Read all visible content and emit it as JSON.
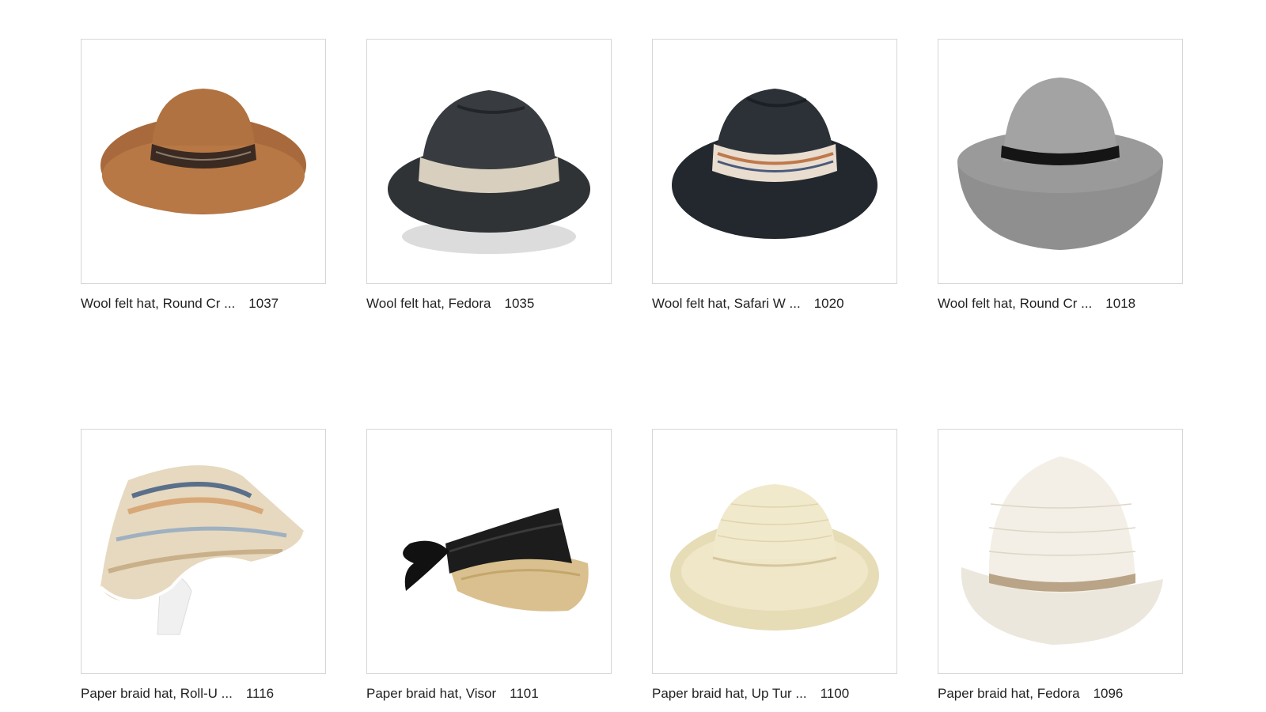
{
  "products": [
    {
      "name": "Wool felt hat, Round Cr ...",
      "code": "1037",
      "image": "brown-wide-brim-felt-hat"
    },
    {
      "name": "Wool felt hat, Fedora",
      "code": "1035",
      "image": "charcoal-fedora-beige-band"
    },
    {
      "name": "Wool felt hat, Safari W ...",
      "code": "1020",
      "image": "navy-safari-hat-patterned-band"
    },
    {
      "name": "Wool felt hat, Round Cr ...",
      "code": "1018",
      "image": "grey-round-crown-felt-hat"
    },
    {
      "name": "Paper braid hat, Roll-U ...",
      "code": "1116",
      "image": "striped-roll-up-sun-visor-on-mannequin"
    },
    {
      "name": "Paper braid hat, Visor",
      "code": "1101",
      "image": "natural-straw-visor-black-scarf"
    },
    {
      "name": "Paper braid hat, Up Tur ...",
      "code": "1100",
      "image": "cream-up-turned-brim-hat"
    },
    {
      "name": "Paper braid hat, Fedora",
      "code": "1096",
      "image": "white-paper-braid-fedora"
    }
  ]
}
